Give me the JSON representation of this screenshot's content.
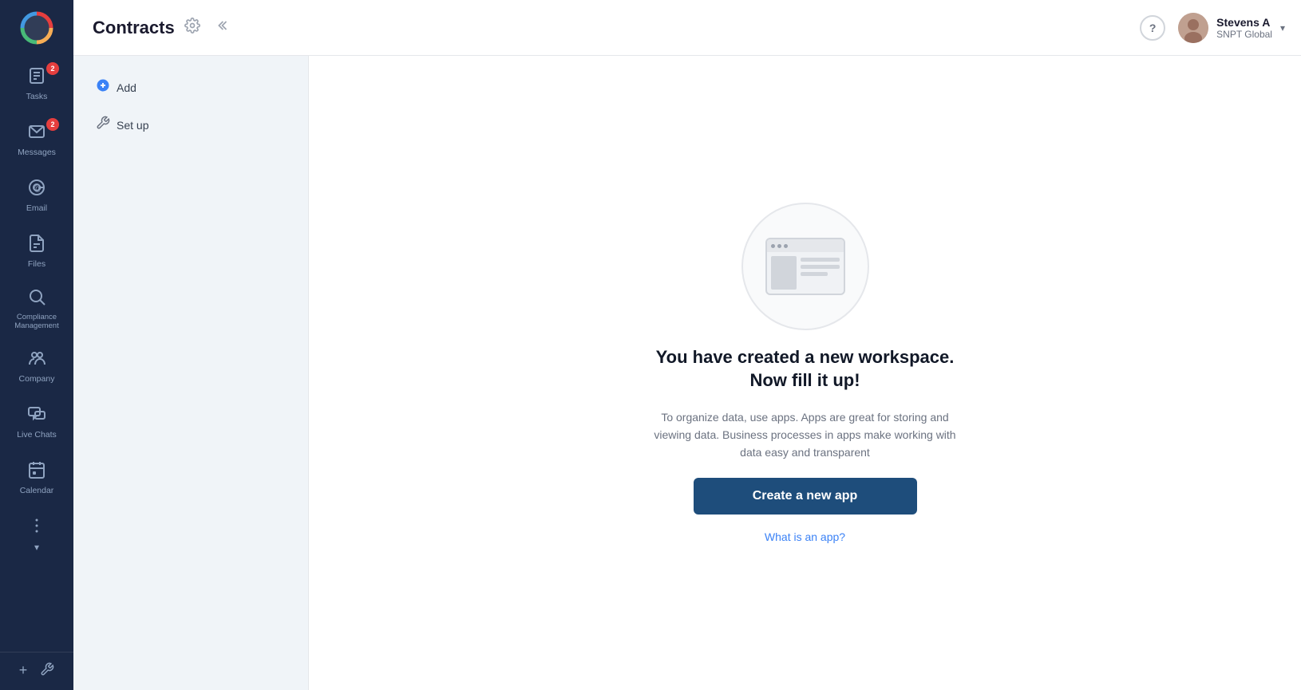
{
  "app": {
    "title": "Contracts"
  },
  "sidebar": {
    "logo_alt": "App Logo",
    "items": [
      {
        "id": "tasks",
        "label": "Tasks",
        "icon": "📋",
        "badge": "2"
      },
      {
        "id": "messages",
        "label": "Messages",
        "icon": "✉️",
        "badge": "2"
      },
      {
        "id": "email",
        "label": "Email",
        "icon": "@",
        "badge": null
      },
      {
        "id": "files",
        "label": "Files",
        "icon": "📄",
        "badge": null
      },
      {
        "id": "compliance",
        "label": "Compliance Management",
        "icon": "🔍",
        "badge": null
      },
      {
        "id": "company",
        "label": "Company",
        "icon": "👥",
        "badge": null
      },
      {
        "id": "livechats",
        "label": "Live Chats",
        "icon": "💬",
        "badge": null
      },
      {
        "id": "calendar",
        "label": "Calendar",
        "icon": "📅",
        "badge": null
      },
      {
        "id": "more",
        "label": "",
        "icon": "⚙️",
        "badge": null
      }
    ],
    "bottom_add": "+",
    "bottom_wrench": "🔧"
  },
  "header": {
    "title": "Contracts",
    "gear_label": "Settings",
    "collapse_label": "Collapse",
    "help_label": "?",
    "user": {
      "name": "Stevens A",
      "org": "SNPT Global",
      "chevron": "▾"
    }
  },
  "left_panel": {
    "items": [
      {
        "id": "add",
        "label": "Add",
        "icon": "➕"
      },
      {
        "id": "setup",
        "label": "Set up",
        "icon": "🔧"
      }
    ]
  },
  "empty_state": {
    "heading": "You have created a new workspace. Now fill it up!",
    "description": "To organize data, use apps. Apps are great for storing and viewing data. Business processes in apps make working with data easy and transparent",
    "create_button": "Create a new app",
    "what_is_link": "What is an app?"
  },
  "colors": {
    "sidebar_bg": "#1a2845",
    "header_bg": "#ffffff",
    "panel_bg": "#f0f4f8",
    "create_btn": "#1e4d7b"
  }
}
